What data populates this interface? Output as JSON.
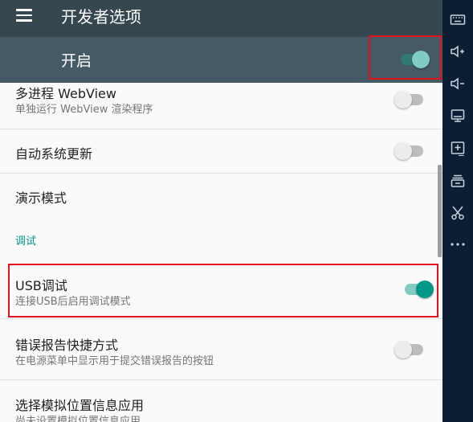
{
  "appbar": {
    "title": "开发者选项"
  },
  "master": {
    "label": "开启",
    "enabled": true
  },
  "settings": {
    "multiprocess_webview": {
      "title": "多进程 WebView",
      "summary": "单独运行 WebView 渲染程序",
      "enabled": false
    },
    "auto_update": {
      "title": "自动系统更新",
      "enabled": false
    },
    "demo_mode": {
      "title": "演示模式"
    },
    "debug_header": "调试",
    "usb_debugging": {
      "title": "USB调试",
      "summary": "连接USB后启用调试模式",
      "enabled": true
    },
    "bug_report_shortcut": {
      "title": "错误报告快捷方式",
      "summary": "在电源菜单中显示用于提交错误报告的按钮",
      "enabled": false
    },
    "mock_location": {
      "title": "选择模拟位置信息应用",
      "summary": "尚未设置模拟位置信息应用"
    }
  },
  "sidebar": {
    "icons": [
      "keyboard-icon",
      "volume-up-icon",
      "volume-down-icon",
      "screen-icon",
      "install-apk-icon",
      "stack-icon",
      "scissors-icon",
      "more-icon"
    ]
  },
  "colors": {
    "appbar": "#37474f",
    "master_bar": "#455a64",
    "accent": "#009688",
    "highlight": "#e0121c",
    "sidebar": "#0c1e33"
  }
}
